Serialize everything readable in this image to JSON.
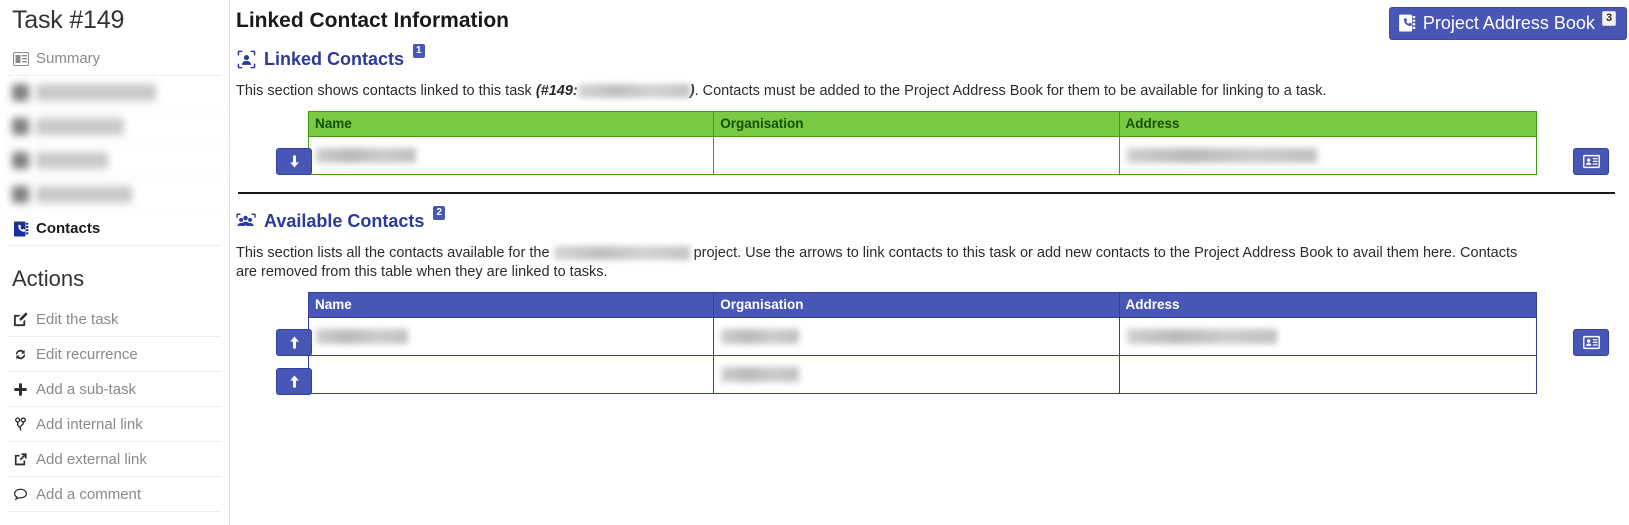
{
  "sidebar": {
    "task_title": "Task #149",
    "nav_items": [
      {
        "label": "Summary",
        "icon": "summary-icon",
        "state": "normal"
      },
      {
        "label": " ",
        "icon": "hidden-icon",
        "state": "blurred"
      },
      {
        "label": " ",
        "icon": "hidden-icon",
        "state": "blurred"
      },
      {
        "label": " ",
        "icon": "hidden-icon",
        "state": "blurred"
      },
      {
        "label": " ",
        "icon": "hidden-icon",
        "state": "blurred"
      },
      {
        "label": "Contacts",
        "icon": "address-book-icon",
        "state": "active"
      }
    ],
    "actions_title": "Actions",
    "actions": [
      {
        "label": "Edit the task",
        "icon": "edit-pencil-icon"
      },
      {
        "label": "Edit recurrence",
        "icon": "refresh-cycle-icon"
      },
      {
        "label": "Add a sub-task",
        "icon": "plus-icon"
      },
      {
        "label": "Add internal link",
        "icon": "branch-icon"
      },
      {
        "label": "Add external link",
        "icon": "external-link-icon"
      },
      {
        "label": "Add a comment",
        "icon": "comment-bubble-icon"
      }
    ]
  },
  "header": {
    "page_title": "Linked Contact Information",
    "address_book_button": {
      "label": "Project Address Book",
      "icon": "address-book-icon",
      "badge": "3"
    }
  },
  "linked_section": {
    "icon": "single-contact-icon",
    "title": "Linked Contacts",
    "badge": "1",
    "desc_part1": "This section shows contacts linked to this task ",
    "desc_emphasis": "(#149:",
    "desc_emphasis_end": ")",
    "desc_part2": ". Contacts must be added to the Project Address Book for them to be available for linking to a task.",
    "columns": [
      "Name",
      "Organisation",
      "Address"
    ],
    "rows": [
      {
        "name": "",
        "organisation": "",
        "address": "",
        "name_redacted": true,
        "organisation_redacted": false,
        "address_redacted": true,
        "row_action_icon": "arrow-down-icon",
        "card_action_icon": "contact-card-icon"
      }
    ]
  },
  "available_section": {
    "icon": "multiple-contacts-icon",
    "title": "Available Contacts",
    "badge": "2",
    "desc_part1": "This section lists all the contacts available for the ",
    "desc_part2": " project. Use the arrows to link contacts to this task or add new contacts to the Project Address Book to avail them here. Contacts are removed from this table when they are linked to tasks.",
    "columns": [
      "Name",
      "Organisation",
      "Address"
    ],
    "rows": [
      {
        "name": "",
        "organisation": "",
        "address": "",
        "name_redacted": true,
        "organisation_redacted": true,
        "address_redacted": true,
        "row_action_icon": "arrow-up-icon",
        "card_action_icon": "contact-card-icon"
      },
      {
        "name": "",
        "organisation": "",
        "address": "",
        "name_redacted": false,
        "organisation_redacted": true,
        "address_redacted": false,
        "row_action_icon": "arrow-up-icon",
        "card_action_icon": null
      }
    ]
  },
  "colors": {
    "accent_blue": "#4857b5",
    "heading_blue": "#2b3a9b",
    "green_header": "#7ac943",
    "green_border": "#3f9a18",
    "text_dark": "#2b2b2b",
    "muted": "#8a8a8a"
  }
}
